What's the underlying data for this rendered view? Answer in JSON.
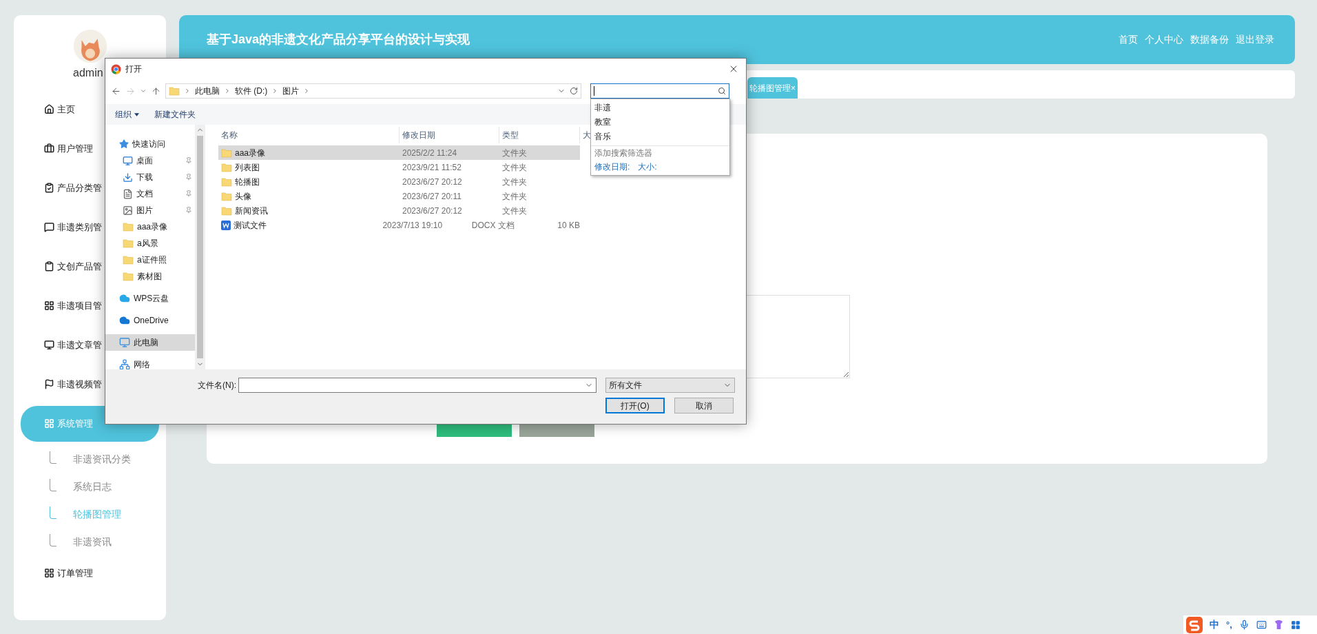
{
  "sidebar": {
    "user": "admin",
    "items": [
      {
        "label": "主页",
        "selected": false
      },
      {
        "label": "用户管理",
        "selected": false
      },
      {
        "label": "产品分类管",
        "selected": false
      },
      {
        "label": "非遗类别管",
        "selected": false
      },
      {
        "label": "文创产品管",
        "selected": false
      },
      {
        "label": "非遗项目管",
        "selected": false
      },
      {
        "label": "非遗文章管",
        "selected": false
      },
      {
        "label": "非遗视频管",
        "selected": false
      },
      {
        "label": "系统管理",
        "selected": true,
        "children": [
          {
            "label": "非遗资讯分类",
            "selected": false
          },
          {
            "label": "系统日志",
            "selected": false
          },
          {
            "label": "轮播图管理",
            "selected": true
          },
          {
            "label": "非遗资讯",
            "selected": false
          }
        ]
      },
      {
        "label": "订单管理",
        "selected": false
      }
    ]
  },
  "header": {
    "title": "基于Java的非遗文化产品分享平台的设计与实现",
    "links": [
      "首页",
      "个人中心",
      "数据备份",
      "退出登录"
    ]
  },
  "tabs": [
    {
      "label": "轮播图管理",
      "close": "×",
      "selected": true
    }
  ],
  "dialog": {
    "title": "打开",
    "path": [
      "此电脑",
      "软件 (D:)",
      "图片"
    ],
    "search": {
      "suggestions": [
        "非遗",
        "教室",
        "音乐"
      ],
      "filter_hint": "添加搜索筛选器",
      "filters": [
        "修改日期:",
        "大小:"
      ]
    },
    "toolbar": [
      {
        "label": "组织",
        "menu": true
      },
      {
        "label": "新建文件夹",
        "menu": false
      }
    ],
    "nav": [
      {
        "label": "快速访问",
        "selected": false,
        "children": [
          {
            "label": "桌面",
            "pinned": true,
            "selected": false
          },
          {
            "label": "下载",
            "pinned": true,
            "selected": false
          },
          {
            "label": "文档",
            "pinned": true,
            "selected": false
          },
          {
            "label": "图片",
            "pinned": true,
            "selected": false
          },
          {
            "label": "aaa录像",
            "pinned": false,
            "selected": false
          },
          {
            "label": "a风景",
            "pinned": false,
            "selected": false
          },
          {
            "label": "a证件照",
            "pinned": false,
            "selected": false
          },
          {
            "label": "素材图",
            "pinned": false,
            "selected": false
          }
        ]
      },
      {
        "label": "WPS云盘",
        "selected": false
      },
      {
        "label": "OneDrive",
        "selected": false
      },
      {
        "label": "此电脑",
        "selected": true
      },
      {
        "label": "网络",
        "selected": false
      }
    ],
    "columns": [
      "名称",
      "修改日期",
      "类型",
      "大"
    ],
    "files": [
      {
        "name": "aaa录像",
        "date": "2025/2/2 11:24",
        "type": "文件夹",
        "kind": "folder",
        "selected": true
      },
      {
        "name": "列表图",
        "date": "2023/9/21 11:52",
        "type": "文件夹",
        "kind": "folder",
        "selected": false
      },
      {
        "name": "轮播图",
        "date": "2023/6/27 20:12",
        "type": "文件夹",
        "kind": "folder",
        "selected": false
      },
      {
        "name": "头像",
        "date": "2023/6/27 20:11",
        "type": "文件夹",
        "kind": "folder",
        "selected": false
      },
      {
        "name": "新闻资讯",
        "date": "2023/6/27 20:12",
        "type": "文件夹",
        "kind": "folder",
        "selected": false
      },
      {
        "name": "测试文件",
        "date": "2023/7/13 19:10",
        "type": "DOCX 文档",
        "size": "10 KB",
        "kind": "document",
        "selected": false
      }
    ],
    "filename_label": "文件名(N):",
    "filetype": "所有文件",
    "buttons": [
      "打开(O)",
      "取消"
    ]
  },
  "tray": {
    "ime_mode": "中",
    "punctuation": "°,"
  }
}
